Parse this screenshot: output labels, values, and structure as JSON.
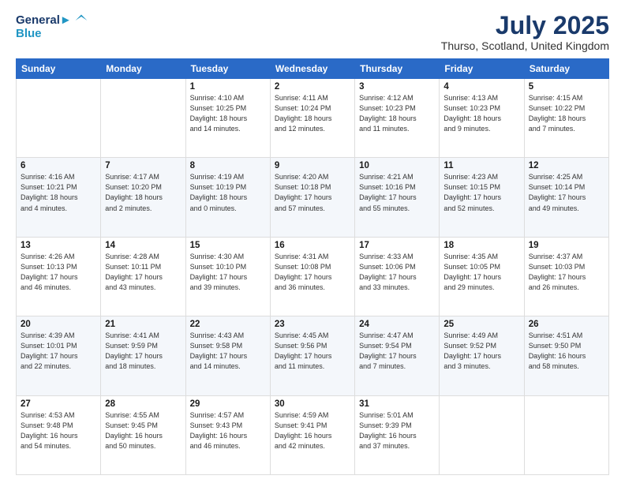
{
  "header": {
    "logo_line1": "General",
    "logo_line2": "Blue",
    "month": "July 2025",
    "location": "Thurso, Scotland, United Kingdom"
  },
  "weekdays": [
    "Sunday",
    "Monday",
    "Tuesday",
    "Wednesday",
    "Thursday",
    "Friday",
    "Saturday"
  ],
  "weeks": [
    [
      {
        "day": "",
        "info": ""
      },
      {
        "day": "",
        "info": ""
      },
      {
        "day": "1",
        "info": "Sunrise: 4:10 AM\nSunset: 10:25 PM\nDaylight: 18 hours\nand 14 minutes."
      },
      {
        "day": "2",
        "info": "Sunrise: 4:11 AM\nSunset: 10:24 PM\nDaylight: 18 hours\nand 12 minutes."
      },
      {
        "day": "3",
        "info": "Sunrise: 4:12 AM\nSunset: 10:23 PM\nDaylight: 18 hours\nand 11 minutes."
      },
      {
        "day": "4",
        "info": "Sunrise: 4:13 AM\nSunset: 10:23 PM\nDaylight: 18 hours\nand 9 minutes."
      },
      {
        "day": "5",
        "info": "Sunrise: 4:15 AM\nSunset: 10:22 PM\nDaylight: 18 hours\nand 7 minutes."
      }
    ],
    [
      {
        "day": "6",
        "info": "Sunrise: 4:16 AM\nSunset: 10:21 PM\nDaylight: 18 hours\nand 4 minutes."
      },
      {
        "day": "7",
        "info": "Sunrise: 4:17 AM\nSunset: 10:20 PM\nDaylight: 18 hours\nand 2 minutes."
      },
      {
        "day": "8",
        "info": "Sunrise: 4:19 AM\nSunset: 10:19 PM\nDaylight: 18 hours\nand 0 minutes."
      },
      {
        "day": "9",
        "info": "Sunrise: 4:20 AM\nSunset: 10:18 PM\nDaylight: 17 hours\nand 57 minutes."
      },
      {
        "day": "10",
        "info": "Sunrise: 4:21 AM\nSunset: 10:16 PM\nDaylight: 17 hours\nand 55 minutes."
      },
      {
        "day": "11",
        "info": "Sunrise: 4:23 AM\nSunset: 10:15 PM\nDaylight: 17 hours\nand 52 minutes."
      },
      {
        "day": "12",
        "info": "Sunrise: 4:25 AM\nSunset: 10:14 PM\nDaylight: 17 hours\nand 49 minutes."
      }
    ],
    [
      {
        "day": "13",
        "info": "Sunrise: 4:26 AM\nSunset: 10:13 PM\nDaylight: 17 hours\nand 46 minutes."
      },
      {
        "day": "14",
        "info": "Sunrise: 4:28 AM\nSunset: 10:11 PM\nDaylight: 17 hours\nand 43 minutes."
      },
      {
        "day": "15",
        "info": "Sunrise: 4:30 AM\nSunset: 10:10 PM\nDaylight: 17 hours\nand 39 minutes."
      },
      {
        "day": "16",
        "info": "Sunrise: 4:31 AM\nSunset: 10:08 PM\nDaylight: 17 hours\nand 36 minutes."
      },
      {
        "day": "17",
        "info": "Sunrise: 4:33 AM\nSunset: 10:06 PM\nDaylight: 17 hours\nand 33 minutes."
      },
      {
        "day": "18",
        "info": "Sunrise: 4:35 AM\nSunset: 10:05 PM\nDaylight: 17 hours\nand 29 minutes."
      },
      {
        "day": "19",
        "info": "Sunrise: 4:37 AM\nSunset: 10:03 PM\nDaylight: 17 hours\nand 26 minutes."
      }
    ],
    [
      {
        "day": "20",
        "info": "Sunrise: 4:39 AM\nSunset: 10:01 PM\nDaylight: 17 hours\nand 22 minutes."
      },
      {
        "day": "21",
        "info": "Sunrise: 4:41 AM\nSunset: 9:59 PM\nDaylight: 17 hours\nand 18 minutes."
      },
      {
        "day": "22",
        "info": "Sunrise: 4:43 AM\nSunset: 9:58 PM\nDaylight: 17 hours\nand 14 minutes."
      },
      {
        "day": "23",
        "info": "Sunrise: 4:45 AM\nSunset: 9:56 PM\nDaylight: 17 hours\nand 11 minutes."
      },
      {
        "day": "24",
        "info": "Sunrise: 4:47 AM\nSunset: 9:54 PM\nDaylight: 17 hours\nand 7 minutes."
      },
      {
        "day": "25",
        "info": "Sunrise: 4:49 AM\nSunset: 9:52 PM\nDaylight: 17 hours\nand 3 minutes."
      },
      {
        "day": "26",
        "info": "Sunrise: 4:51 AM\nSunset: 9:50 PM\nDaylight: 16 hours\nand 58 minutes."
      }
    ],
    [
      {
        "day": "27",
        "info": "Sunrise: 4:53 AM\nSunset: 9:48 PM\nDaylight: 16 hours\nand 54 minutes."
      },
      {
        "day": "28",
        "info": "Sunrise: 4:55 AM\nSunset: 9:45 PM\nDaylight: 16 hours\nand 50 minutes."
      },
      {
        "day": "29",
        "info": "Sunrise: 4:57 AM\nSunset: 9:43 PM\nDaylight: 16 hours\nand 46 minutes."
      },
      {
        "day": "30",
        "info": "Sunrise: 4:59 AM\nSunset: 9:41 PM\nDaylight: 16 hours\nand 42 minutes."
      },
      {
        "day": "31",
        "info": "Sunrise: 5:01 AM\nSunset: 9:39 PM\nDaylight: 16 hours\nand 37 minutes."
      },
      {
        "day": "",
        "info": ""
      },
      {
        "day": "",
        "info": ""
      }
    ]
  ]
}
